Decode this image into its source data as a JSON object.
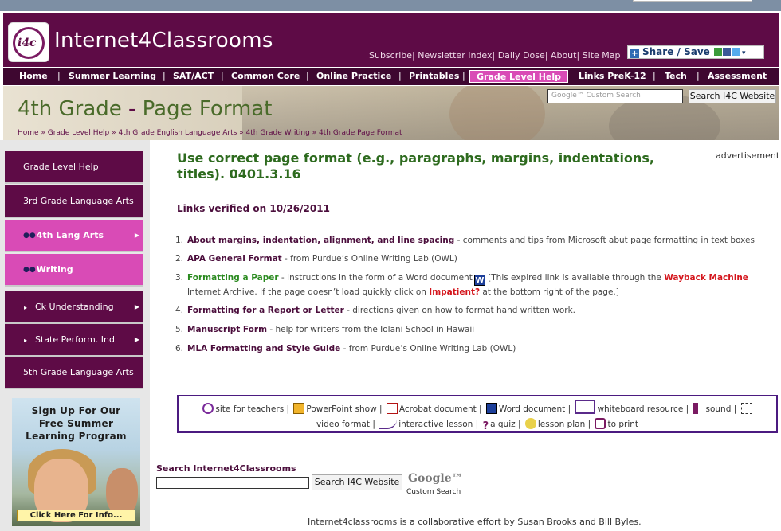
{
  "site": {
    "logo_mark": "i4c",
    "name": "Internet4Classrooms"
  },
  "top_links": [
    "Subscribe",
    "Newsletter Index",
    "Daily Dose",
    "About",
    "Site Map"
  ],
  "share_label": "Share / Save",
  "nav": [
    "Home",
    "Summer Learning",
    "SAT/ACT",
    "Common Core",
    "Online Practice",
    "Printables",
    "Grade Level Help",
    "Links PreK-12",
    "Tech",
    "Assessment"
  ],
  "nav_active": "Grade Level Help",
  "banner": {
    "title_a": "4th Grade",
    "title_sep": " - ",
    "title_b": "Page Format",
    "breadcrumb": "Home » Grade Level Help » 4th Grade English Language Arts » 4th Grade Writing » 4th Grade Page Format",
    "search_placeholder": "Google™ Custom Search",
    "search_button": "Search I4C Website"
  },
  "sidebar": [
    {
      "label": "Grade Level Help"
    },
    {
      "label": "3rd Grade Language Arts"
    },
    {
      "label": "4th Lang Arts"
    },
    {
      "label": "Writing"
    },
    {
      "label": "Ck Understanding"
    },
    {
      "label": "State Perform. Ind"
    },
    {
      "label": "5th Grade Language Arts"
    }
  ],
  "promo": {
    "line1": "Sign Up For Our",
    "line2": "Free Summer",
    "line3": "Learning Program",
    "click": "Click Here For Info..."
  },
  "main": {
    "heading": "Use correct page format (e.g., paragraphs, margins, indentations, titles). 0401.3.16",
    "advertisement": "advertisement",
    "verified": "Links verified on 10/26/2011",
    "items": [
      {
        "num": "1.",
        "link": "About margins, indentation, alignment, and line spacing",
        "desc": " - comments and tips from Microsoft abut page formatting in text boxes"
      },
      {
        "num": "2.",
        "link": "APA General Format",
        "desc": " - from Purdue’s Online Writing Lab (OWL)"
      },
      {
        "num": "3.",
        "link": "Formatting a Paper",
        "desc": " - Instructions in the form of a Word document",
        "word_icon": "W",
        "note_a": " [This expired link is available through the ",
        "wayback": "Wayback Machine",
        "note_b": " Internet Archive. If the page doesn’t load quickly click on ",
        "impatient": "Impatient?",
        "note_c": " at the bottom right of the page.]"
      },
      {
        "num": "4.",
        "link": "Formatting for a Report or Letter",
        "desc": " - directions given on how to format hand written work."
      },
      {
        "num": "5.",
        "link": "Manuscript Form",
        "desc": " - help for writers from the Iolani School in Hawaii"
      },
      {
        "num": "6.",
        "link": "MLA Formatting and Style Guide",
        "desc": " - from Purdue’s Online Writing Lab (OWL)"
      }
    ]
  },
  "legend": {
    "site_for_teachers": "site for teachers",
    "powerpoint": "PowerPoint show",
    "acrobat": "Acrobat document",
    "word": "Word document",
    "whiteboard": "whiteboard resource",
    "sound": "sound",
    "video": "video format",
    "interactive": "interactive lesson",
    "quiz": "a quiz",
    "lesson_plan": "lesson plan",
    "print": "to print",
    "sep": " | "
  },
  "bottom_search": {
    "label": "Search Internet4Classrooms",
    "button": "Search I4C Website",
    "google": "Google™",
    "custom": "Custom Search"
  },
  "footer": "Internet4classrooms is a collaborative effort by Susan Brooks and Bill Byles."
}
